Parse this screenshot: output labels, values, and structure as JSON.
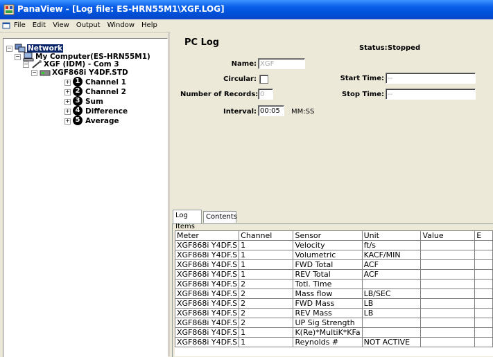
{
  "window": {
    "title": "PanaView - [Log file: ES-HRN55M1\\XGF.LOG]"
  },
  "menu": [
    "File",
    "Edit",
    "View",
    "Output",
    "Window",
    "Help"
  ],
  "tree": {
    "network": "Network",
    "computer": "My Computer(ES-HRN55M1)",
    "device": "XGF (IDM) - Com 3",
    "meter": "XGF868i Y4DF.STD",
    "channels": [
      {
        "num": "1",
        "label": "Channel 1"
      },
      {
        "num": "2",
        "label": "Channel 2"
      },
      {
        "num": "3",
        "label": "Sum"
      },
      {
        "num": "4",
        "label": "Difference"
      },
      {
        "num": "5",
        "label": "Average"
      }
    ]
  },
  "pclog": {
    "title": "PC Log",
    "status_label": "Status:",
    "status_value": "Stopped",
    "name_label": "Name:",
    "name_value": "XGF",
    "circular_label": "Circular:",
    "records_label": "Number of Records:",
    "records_value": "0",
    "interval_label": "Interval:",
    "interval_value": "00:05",
    "interval_units": "MM:SS",
    "start_label": "Start Time:",
    "start_value": "--",
    "stop_label": "Stop Time:",
    "stop_value": "--"
  },
  "tabs": [
    "Log Items",
    "Contents"
  ],
  "grid": {
    "headers": [
      "Meter",
      "Channel",
      "Sensor",
      "Unit",
      "Value",
      "E"
    ],
    "rows": [
      [
        "XGF868i Y4DF.S",
        "1",
        "Velocity",
        "ft/s",
        "",
        ""
      ],
      [
        "XGF868i Y4DF.S",
        "1",
        "Volumetric",
        "KACF/MIN",
        "",
        ""
      ],
      [
        "XGF868i Y4DF.S",
        "1",
        "FWD Total",
        "ACF",
        "",
        ""
      ],
      [
        "XGF868i Y4DF.S",
        "1",
        "REV Total",
        "ACF",
        "",
        ""
      ],
      [
        "XGF868i Y4DF.S",
        "2",
        "Totl. Time",
        "",
        "",
        ""
      ],
      [
        "XGF868i Y4DF.S",
        "2",
        "Mass flow",
        "LB/SEC",
        "",
        ""
      ],
      [
        "XGF868i Y4DF.S",
        "2",
        "FWD Mass",
        "LB",
        "",
        ""
      ],
      [
        "XGF868i Y4DF.S",
        "2",
        "REV Mass",
        "LB",
        "",
        ""
      ],
      [
        "XGF868i Y4DF.S",
        "2",
        "UP Sig Strength",
        "",
        "",
        ""
      ],
      [
        "XGF868i Y4DF.S",
        "1",
        "K(Re)*MultiK*KFa",
        "",
        "",
        ""
      ],
      [
        "XGF868i Y4DF.S",
        "1",
        "Reynolds #",
        "NOT ACTIVE",
        "",
        ""
      ]
    ]
  },
  "colors": {
    "titlebar": "#0a5ee8",
    "selection": "#0a246a",
    "window_bg": "#ece9d8"
  }
}
